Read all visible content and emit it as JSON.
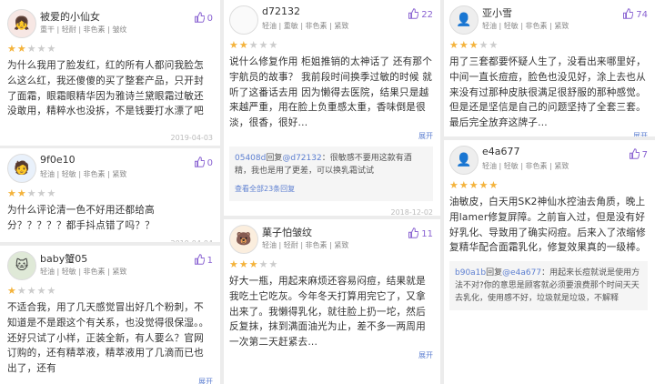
{
  "like_color": "#8a63d2",
  "star_color": "#f4b33c",
  "c1": {
    "user": "被爱的小仙女",
    "tags": "重干 | 轻耐 | 非色素 | 皱纹",
    "likes": "0",
    "stars": 2,
    "body": "为什么我用了脸发红，红的所有人都问我脸怎么这么红，我还傻傻的买了整套产品，只开封了面霜，眼霜眼精华因为雅诗兰黛眼霜过敏还没敢用，精粹水也没拆，不是钱要打水漂了吧",
    "date": "2019-04-03"
  },
  "c2": {
    "user": "9f0e10",
    "tags": "轻油 | 轻敏 | 非色素 | 紧致",
    "likes": "0",
    "stars": 2,
    "body": "为什么评论清一色不好用还都给高分？？？？？都手抖点错了吗？？",
    "date": "2019-04-04"
  },
  "c3": {
    "user": "baby蟹05",
    "tags": "轻油 | 轻敏 | 非色素 | 紧致",
    "likes": "1",
    "stars": 1,
    "body": "不适合我，用了几天感觉冒出好几个粉刺，不知道是不是跟这个有关系，也没觉得很保湿。。还好只试了小样，正装全新，有人要么？官网订购的，还有精萃液，精萃液用了几滴而已也出了，还有",
    "more": "展开"
  },
  "c4": {
    "user": "d72132",
    "tags": "轻油 | 重敏 | 非色素 | 紧致",
    "likes": "22",
    "stars": 2,
    "body": "说什么修复作用 柜姐推销的太神话了 还有那个宇航员的故事？ 我前段时间换季过敏的时候 就听了这番话去用 因为懒得去医院，结果只是越来越严重，用在脸上负重感太重，香味倒是很淡，很香，很好...",
    "more": "展开",
    "reply_user": "05408d",
    "reply_mid": "回复",
    "reply_target": "@d72132",
    "reply_text": "：很敏感不要用这款有酒精，我也是用了更差，可以换乳霜试试",
    "view_all": "查看全部23条回复",
    "date": "2018-12-02"
  },
  "c5": {
    "user": "菓子怕皱纹",
    "tags": "轻油 | 轻耐 | 非色素 | 紧致",
    "likes": "11",
    "stars": 3,
    "body": "好大一瓶，用起来麻烦还容易闷痘，结果就是我吃土它吃灰。今年冬天打算用完它了，又拿出来了。我懒得乳化，就往脸上扔一坨，然后反复抹，抹到满面油光为止，差不多一两周用一次第二天赶紧去...",
    "more": "展开"
  },
  "c6": {
    "user": "亚小雪",
    "tags": "轻油 | 轻敏 | 非色素 | 紧致",
    "likes": "74",
    "stars": 3,
    "body": "用了三套都要怀疑人生了，没看出来哪里好，中间一直长痘痘，脸色也没见好，涂上去也从来没有过那种皮肤很满足很舒服的那种感觉。但是还是坚信是自己的问题坚持了全套三套。最后完全放弃这牌子...",
    "more": "展开"
  },
  "c7": {
    "user": "e4a677",
    "tags": "轻油 | 轻敏 | 非色素 | 紧致",
    "likes": "7",
    "stars": 5,
    "body": "油敏皮，白天用SK2神仙水控油去角质，晚上用lamer修复屏障。之前盲入过，但是没有好好乳化、导致用了确实闷痘。后来入了浓缩修复精华配合面霜乳化，修复效果真的一级棒。",
    "reply_user": "b90a1b",
    "reply_mid": "回复",
    "reply_target": "@e4a677",
    "reply_text": "：用起来长痘就说是使用方法不对?你的意思是顾客就必须要浪费那个时间天天去乳化，使用感不好，垃圾就是垃圾，不解释"
  }
}
